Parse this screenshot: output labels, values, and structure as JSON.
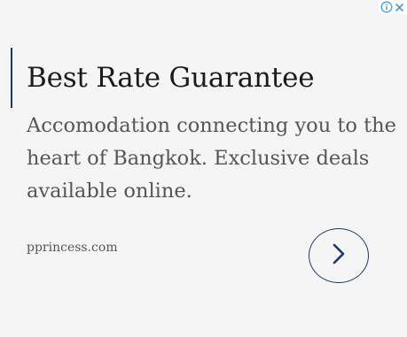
{
  "ad": {
    "headline": "Best Rate Guarantee",
    "description": "Accomodation connecting you to the heart of Bangkok. Exclusive deals available online.",
    "display_url": "pprincess.com",
    "cta_icon": "chevron-right-icon",
    "adchoices_icon": "info-icon",
    "close_icon": "close-icon"
  },
  "colors": {
    "background": "#f5f5f5",
    "accent": "#1b3a66",
    "headline_text": "#1b1b1b",
    "body_text": "#555555",
    "adchoices_blue": "#3aa0d8"
  }
}
